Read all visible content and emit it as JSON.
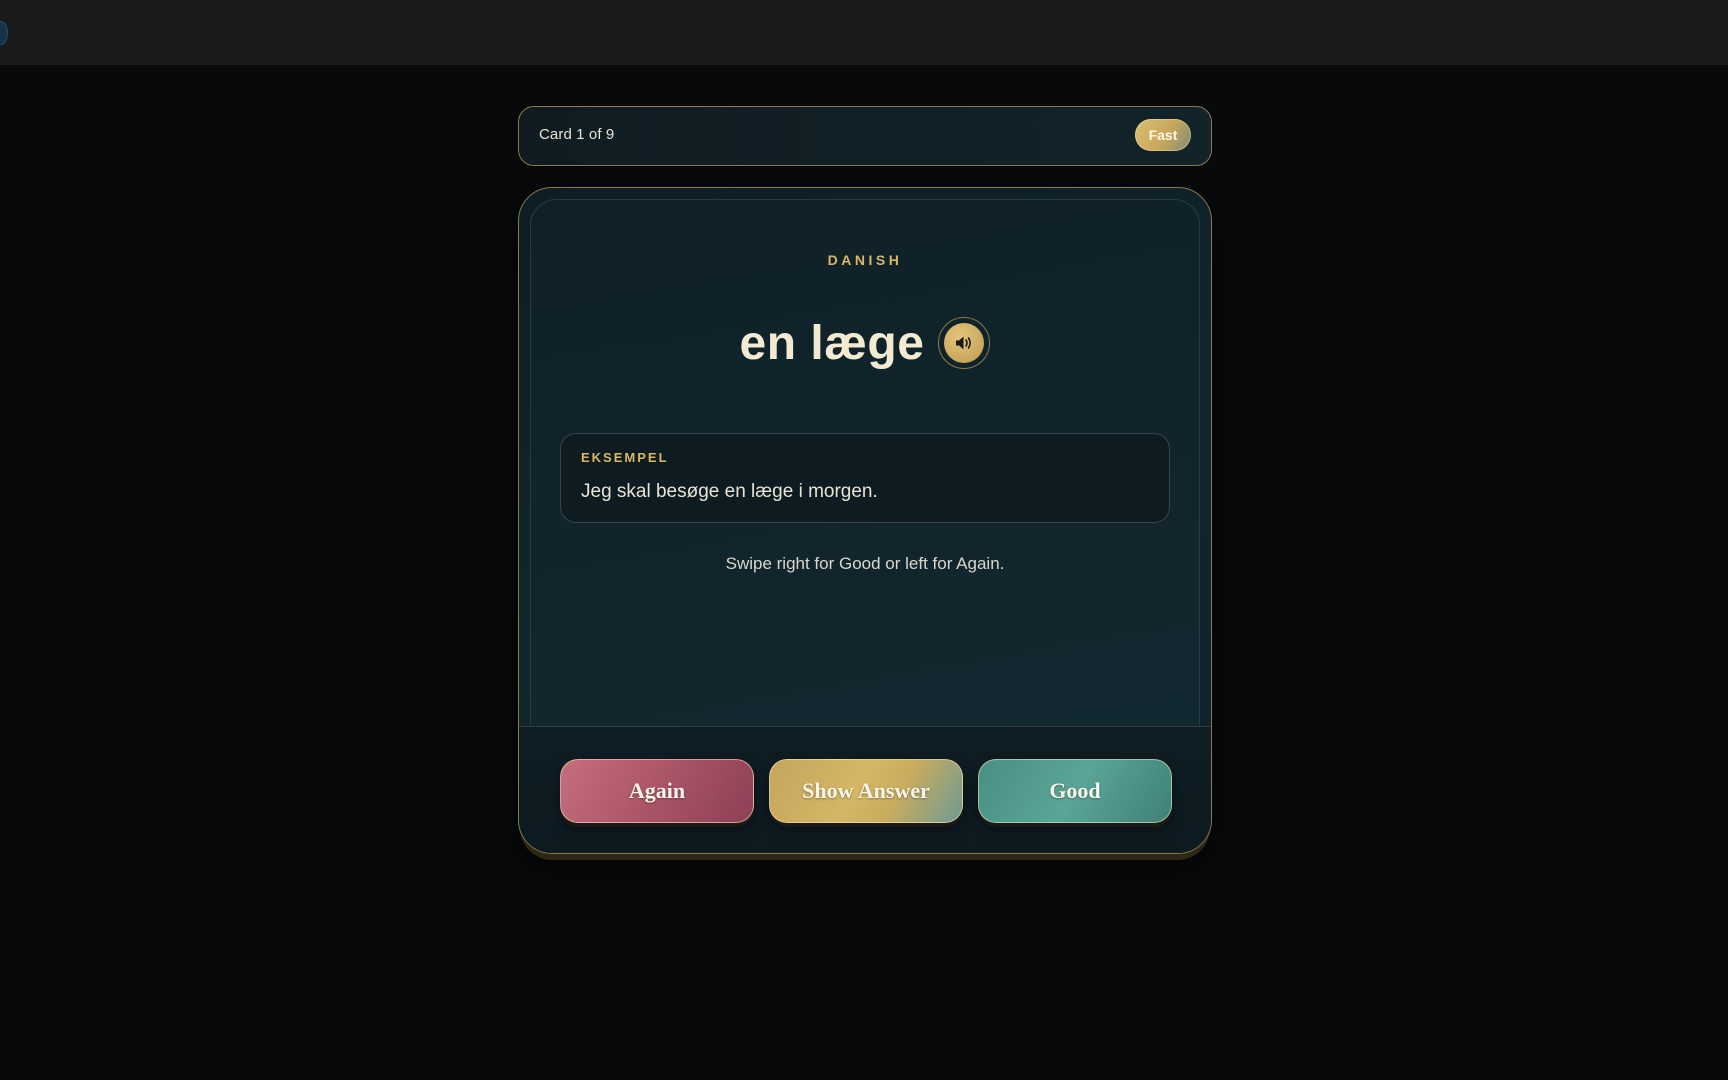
{
  "header": {
    "counter": "Card 1 of 9",
    "mode": "Fast"
  },
  "card": {
    "language": "DANISH",
    "word": "en læge",
    "audio_icon": "speaker-icon",
    "example": {
      "label": "EKSEMPEL",
      "text": "Jeg skal besøge en læge i morgen."
    },
    "hint": "Swipe right for Good or left for Again."
  },
  "actions": {
    "again": "Again",
    "show_answer": "Show Answer",
    "good": "Good"
  },
  "colors": {
    "accent_gold": "#d8b865",
    "again": "#a85265",
    "good": "#5aa597",
    "background": "#08090b"
  }
}
